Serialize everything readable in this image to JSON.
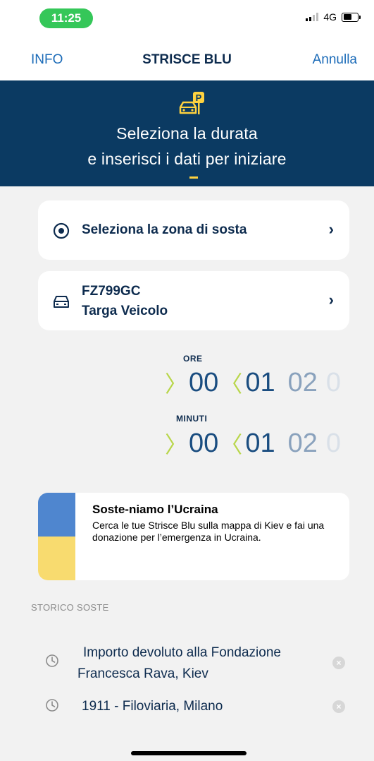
{
  "status_bar": {
    "time": "11:25",
    "network": "4G"
  },
  "navbar": {
    "left": "INFO",
    "title": "STRISCE BLU",
    "right": "Annulla"
  },
  "banner": {
    "line1": "Seleziona la durata",
    "line2": "e inserisci i dati per iniziare",
    "icon": "car-parking-icon"
  },
  "zone_card": {
    "label": "Seleziona la zona di sosta",
    "icon": "location-pin-icon"
  },
  "plate_card": {
    "plate": "FZ799GC",
    "label": "Targa Veicolo",
    "icon": "car-icon"
  },
  "duration": {
    "hours_label": "ORE",
    "hours": [
      "00",
      "01",
      "02",
      "0"
    ],
    "minutes_label": "MINUTI",
    "minutes": [
      "00",
      "01",
      "02",
      "0"
    ]
  },
  "ukraine": {
    "title": "Soste-niamo l’Ucraina",
    "description": "Cerca le tue Strisce Blu sulla mappa di Kiev e fai una donazione per l’emergenza in Ucraina."
  },
  "history": {
    "header": "STORICO SOSTE",
    "items": [
      {
        "line1": "Importo devoluto alla Fondazione",
        "line2": "Francesca Rava, Kiev"
      },
      {
        "line1": "1911 - Filoviaria, Milano"
      }
    ]
  },
  "colors": {
    "primary_navy": "#0b3a62",
    "link_blue": "#1b6bb8",
    "accent_green": "#b8d64a",
    "accent_yellow": "#ffd23f"
  }
}
